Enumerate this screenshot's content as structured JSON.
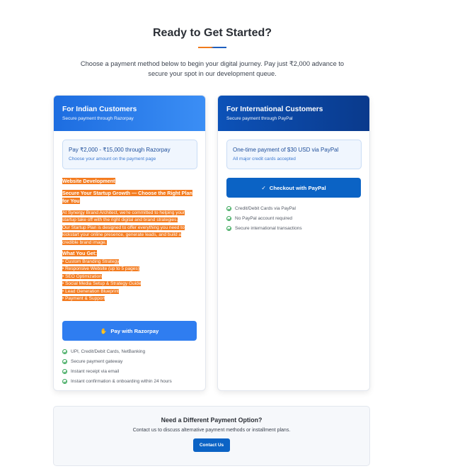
{
  "page": {
    "title": "Ready to Get Started?",
    "intro_line1": "Choose a payment method below to begin your digital journey. Pay just ₹2,000 advance to",
    "intro_line2": "secure your spot in our development queue."
  },
  "india_card": {
    "header_title": "For Indian Customers",
    "header_subtitle": "Secure payment through Razorpay",
    "price_main": "Pay ₹2,000 - ₹15,000 through Razorpay",
    "price_sub": "Choose your amount on the payment page",
    "description": {
      "heading": "Website Development",
      "tagline_line1": "Secure Your Startup Growth — Choose the Right Plan",
      "tagline_line2": "for You",
      "body_lines": [
        "At Synergy Brand Architect, we're committed to helping your",
        "startup take off with the right digital and brand strategies.",
        "Our Startup Plan is designed to offer everything you need to",
        "kickstart your online presence, generate leads, and build a",
        "credible brand image."
      ],
      "list_heading": "What You Get:",
      "list_items": [
        "• Custom Branding Strategy",
        "• Responsive Website (up to 5 pages)",
        "• SEO Optimization",
        "• Social Media Setup & Strategy Guide",
        "• Lead Generation Blueprint",
        "• Payment & Support"
      ]
    },
    "button_icon": "✋",
    "button_label": "Pay with Razorpay",
    "features": [
      "UPI, Credit/Debit Cards, NetBanking",
      "Secure payment gateway",
      "Instant receipt via email",
      "Instant confirmation & onboarding within 24 hours"
    ]
  },
  "intl_card": {
    "header_title": "For International Customers",
    "header_subtitle": "Secure payment through PayPal",
    "price_main": "One-time payment of $30 USD via PayPal",
    "price_sub": "All major credit cards accepted",
    "button_icon": "✓",
    "button_label": "Checkout with PayPal",
    "features": [
      "Credit/Debit Cards via PayPal",
      "No PayPal account required",
      "Secure international transactions"
    ]
  },
  "alternative": {
    "title": "Need a Different Payment Option?",
    "subtitle": "Contact us to discuss alternative payment methods or installment plans.",
    "button_label": "Contact Us"
  },
  "colors": {
    "accent_blue": "#2f7df0",
    "paypal_blue": "#0b63c5",
    "highlight_orange": "#f47c20",
    "check_green": "#3aa75a"
  },
  "icons": {
    "razorpay_button": "hand-icon",
    "paypal_button": "checkmark-icon",
    "feature_bullet": "check-circle-icon"
  }
}
